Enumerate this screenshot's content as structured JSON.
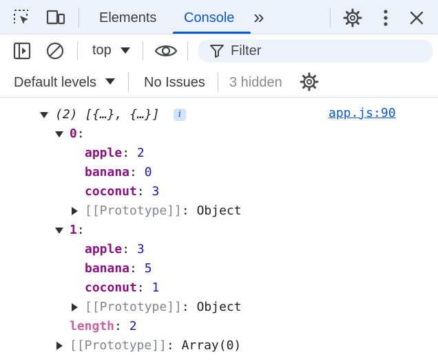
{
  "tabs": {
    "elements_label": "Elements",
    "console_label": "Console",
    "more_label": "»"
  },
  "toolbar": {
    "context_label": "top",
    "filter_placeholder": "Filter",
    "levels_label": "Default levels",
    "issues_label": "No Issues",
    "hidden_label": "3 hidden"
  },
  "icons": {
    "inspect": "inspect-element-icon",
    "device": "device-toolbar-icon",
    "settings": "gear-icon",
    "menu": "vertical-dots-icon",
    "close": "close-icon",
    "sidebar": "sidebar-toggle-icon",
    "clear": "clear-console-icon",
    "eye": "eye-icon",
    "filter": "filter-icon",
    "info": "info-icon"
  },
  "colors": {
    "accent": "#0b57d0",
    "key": "#881280",
    "number": "#1a1aa6"
  },
  "log": {
    "summary": "(2) [{…}, {…}]",
    "info_glyph": "i",
    "source": "app.js:90",
    "items": [
      {
        "index": "0",
        "props": [
          {
            "key": "apple",
            "value": "2"
          },
          {
            "key": "banana",
            "value": "0"
          },
          {
            "key": "coconut",
            "value": "3"
          }
        ],
        "proto_label": "[[Prototype]]",
        "proto_value": "Object"
      },
      {
        "index": "1",
        "props": [
          {
            "key": "apple",
            "value": "3"
          },
          {
            "key": "banana",
            "value": "5"
          },
          {
            "key": "coconut",
            "value": "1"
          }
        ],
        "proto_label": "[[Prototype]]",
        "proto_value": "Object"
      }
    ],
    "length_key": "length",
    "length_value": "2",
    "array_proto_label": "[[Prototype]]",
    "array_proto_value": "Array(0)"
  }
}
